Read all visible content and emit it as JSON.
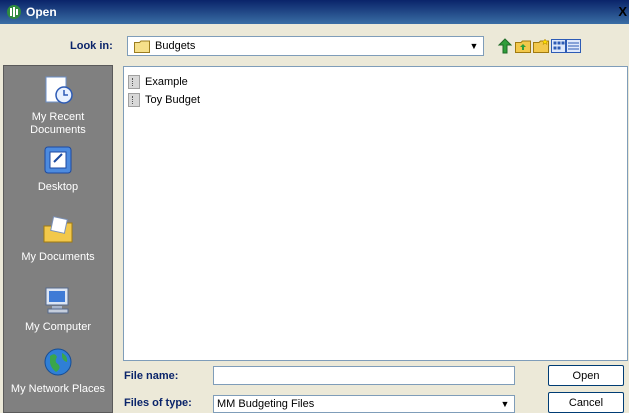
{
  "window": {
    "title": "Open",
    "close_glyph": "X"
  },
  "lookin": {
    "label": "Look in:",
    "value": "Budgets",
    "arrow": "▼"
  },
  "toolbar": {
    "icons": [
      "back-icon",
      "up-folder-icon",
      "new-folder-icon",
      "view-menu-icon"
    ]
  },
  "places": [
    {
      "label": "My Recent Documents",
      "icon": "recent-documents-icon"
    },
    {
      "label": "Desktop",
      "icon": "desktop-icon"
    },
    {
      "label": "My Documents",
      "icon": "my-documents-icon"
    },
    {
      "label": "My Computer",
      "icon": "my-computer-icon"
    },
    {
      "label": "My Network Places",
      "icon": "network-places-icon"
    }
  ],
  "files": [
    {
      "name": "Example",
      "icon": "budget-file-icon"
    },
    {
      "name": "Toy Budget",
      "icon": "budget-file-icon"
    }
  ],
  "filename": {
    "label": "File name:",
    "value": "",
    "placeholder": ""
  },
  "filetype": {
    "label": "Files of type:",
    "value": "MM Budgeting Files",
    "arrow": "▼"
  },
  "buttons": {
    "open": "Open",
    "cancel": "Cancel"
  },
  "colors": {
    "title_bar": "#0a246a",
    "places_bar": "#808080",
    "label_blue": "#0a246a",
    "dialog_bg": "#ece9d8"
  }
}
